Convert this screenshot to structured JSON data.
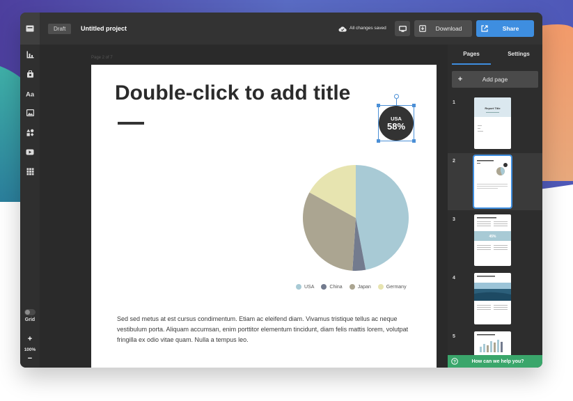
{
  "header": {
    "draft_badge": "Draft",
    "project_title": "Untitled project",
    "save_status": "All changes saved",
    "download_label": "Download",
    "share_label": "Share"
  },
  "toolbar": {
    "tools": [
      "chart-icon",
      "photo-bag-icon",
      "text-icon",
      "image-icon",
      "shapes-icon",
      "video-icon",
      "widgets-icon"
    ],
    "grid_label": "Grid",
    "zoom_in": "+",
    "zoom_level": "100%",
    "zoom_out": "−"
  },
  "canvas": {
    "page_indicator": "Page 2 of 7",
    "title": "Double-click to add title",
    "badge": {
      "country": "USA",
      "percent": "58%"
    },
    "body_text": "Sed sed metus at est cursus condimentum. Etiam ac eleifend diam. Vivamus tristique tellus ac neque vestibulum porta. Aliquam accumsan, enim porttitor elementum tincidunt, diam felis mattis lorem, volutpat fringilla ex odio vitae quam. Nulla a tempus leo."
  },
  "chart_data": {
    "type": "pie",
    "categories": [
      "USA",
      "China",
      "Japan",
      "Germany"
    ],
    "values": [
      47,
      4,
      32,
      17
    ],
    "colors": [
      "#a8cad5",
      "#737b8e",
      "#aba591",
      "#e7e4b0"
    ],
    "title": "",
    "legend_position": "bottom-right"
  },
  "panel": {
    "tab_pages": "Pages",
    "tab_settings": "Settings",
    "add_page_label": "Add page",
    "pages": [
      "1",
      "2",
      "3",
      "4",
      "5"
    ],
    "thumb1_title": "Report Title",
    "thumb3_stat": "45%",
    "help_label": "How can we help you?"
  }
}
